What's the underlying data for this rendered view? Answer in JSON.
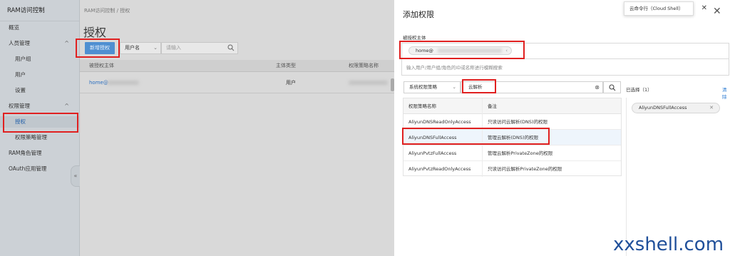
{
  "sidebar": {
    "title": "RAM访问控制",
    "items": [
      {
        "label": "概览"
      },
      {
        "label": "人员管理",
        "chevron": "^"
      },
      {
        "label": "用户组"
      },
      {
        "label": "用户"
      },
      {
        "label": "设置"
      },
      {
        "label": "权限管理",
        "chevron": "^"
      },
      {
        "label": "授权"
      },
      {
        "label": "权限策略管理"
      },
      {
        "label": "RAM角色管理"
      },
      {
        "label": "OAuth应用管理"
      }
    ],
    "collapse_icon": "«"
  },
  "main": {
    "breadcrumb": "RAM访问控制  /  授权",
    "title": "授权",
    "new_button": "新增授权",
    "user_select": "用户名",
    "search_placeholder": "请输入",
    "columns": [
      "被授权主体",
      "主体类型",
      "权限策略名称"
    ],
    "row": {
      "principal": "home@",
      "type": "用户"
    }
  },
  "panel": {
    "title": "添加权限",
    "cloud_shell": "云命令行（Cloud Shell）",
    "principal_label": "被授权主体",
    "principal_tag": "home@",
    "principal_placeholder": "输入用户/用户组/角色的ID或名称进行模糊搜索",
    "policy_type": "系统权限策略",
    "search_value": "云解析",
    "table_headers": [
      "权限策略名称",
      "备注"
    ],
    "policies": [
      {
        "name": "AliyunDNSReadOnlyAccess",
        "note": "只读访问云解析(DNS)的权限"
      },
      {
        "name": "AliyunDNSFullAccess",
        "note": "管理云解析(DNS)的权限"
      },
      {
        "name": "AliyunPvtzFullAccess",
        "note": "管理云解析PrivateZone的权限"
      },
      {
        "name": "AliyunPvtzReadOnlyAccess",
        "note": "只读访问云解析PrivateZone的权限"
      }
    ],
    "selected_label": "已选择（1）",
    "clear_label": "清除",
    "selected_items": [
      "AliyunDNSFullAccess"
    ]
  },
  "watermark": "xxshell.com",
  "colors": {
    "highlight": "#e02020",
    "primary": "#4f8fd1",
    "link": "#2a7ad2"
  }
}
